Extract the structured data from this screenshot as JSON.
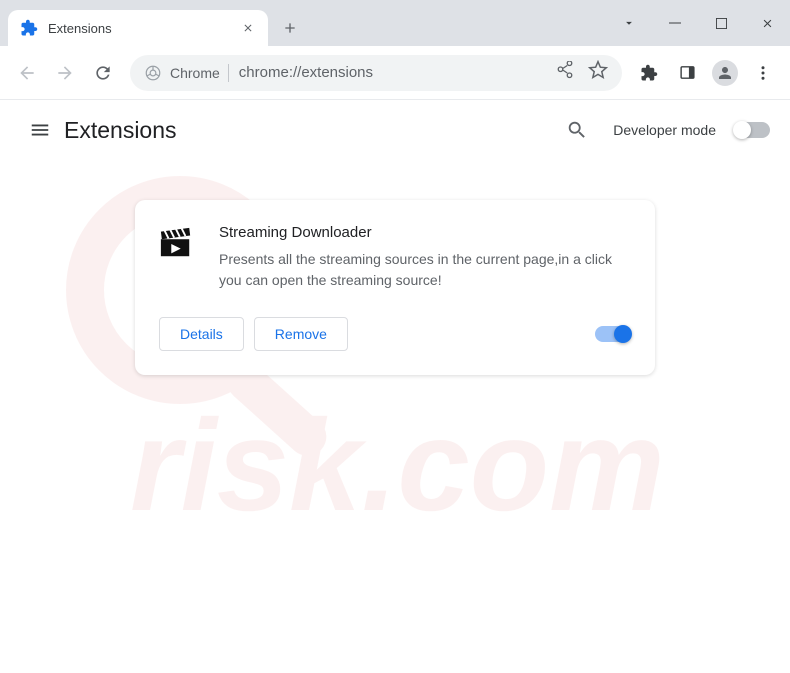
{
  "tab": {
    "title": "Extensions"
  },
  "addr": {
    "label": "Chrome",
    "url": "chrome://extensions"
  },
  "header": {
    "title": "Extensions",
    "dev_mode": "Developer mode"
  },
  "ext": {
    "name": "Streaming Downloader",
    "desc": "Presents all the streaming sources in the current page,in a click you can open the streaming source!",
    "details": "Details",
    "remove": "Remove"
  },
  "watermark": "PCrisk.com"
}
